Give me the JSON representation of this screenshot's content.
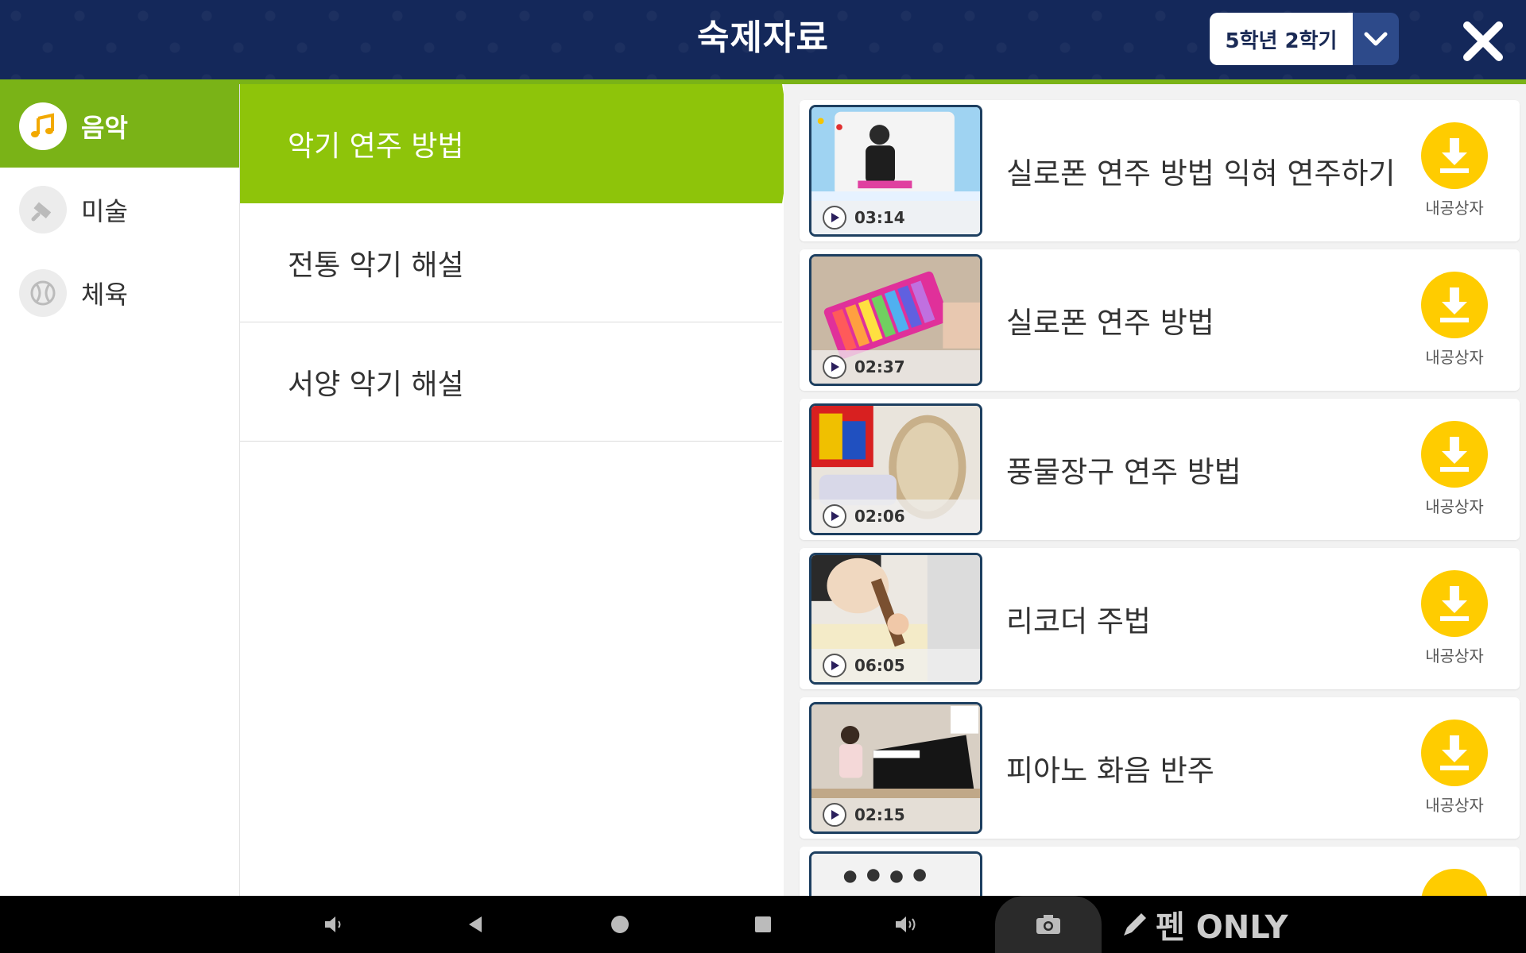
{
  "header": {
    "title": "숙제자료",
    "semester": "5학년 2학기",
    "colors": {
      "background": "#14285a",
      "accent": "#7ab317"
    }
  },
  "sidebar": {
    "items": [
      {
        "label": "음악",
        "icon": "music-note-icon",
        "active": true
      },
      {
        "label": "미술",
        "icon": "paint-brush-icon",
        "active": false
      },
      {
        "label": "체육",
        "icon": "ball-icon",
        "active": false
      }
    ]
  },
  "categories": {
    "items": [
      {
        "label": "악기 연주 방법",
        "active": true
      },
      {
        "label": "전통 악기 해설",
        "active": false
      },
      {
        "label": "서양 악기 해설",
        "active": false
      }
    ]
  },
  "videos": {
    "download_label": "내공상자",
    "items": [
      {
        "title": "실로폰 연주 방법 익혀 연주하기",
        "duration": "03:14",
        "thumb": "xylophone-player"
      },
      {
        "title": "실로폰 연주 방법",
        "duration": "02:37",
        "thumb": "xylophone"
      },
      {
        "title": "풍물장구 연주 방법",
        "duration": "02:06",
        "thumb": "janggu-drum"
      },
      {
        "title": "리코더 주법",
        "duration": "06:05",
        "thumb": "recorder"
      },
      {
        "title": "피아노 화음 반주",
        "duration": "02:15",
        "thumb": "piano"
      }
    ]
  },
  "navbar": {
    "pen_only_label": "펜 ONLY"
  }
}
